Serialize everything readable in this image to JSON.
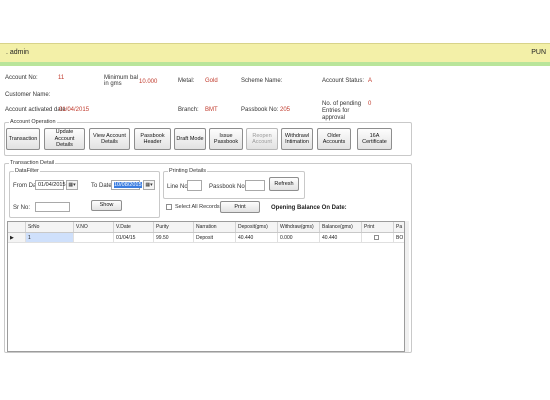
{
  "topbar": {
    "user": ". admin",
    "branch": "PUN"
  },
  "account": {
    "account_no_label": "Account No:",
    "account_no": "11",
    "min_bal_label": "Minimum bal in gms",
    "min_bal": "10.000",
    "metal_label": "Metal:",
    "metal": "Gold",
    "scheme_label": "Scheme Name:",
    "scheme": "",
    "status_label": "Account Status:",
    "status": "A",
    "customer_label": "Customer Name:",
    "customer": "",
    "activated_label": "Account activated date :",
    "activated": "01/04/2015",
    "branch_label": "Branch:",
    "branch": "BMT",
    "passbook_label": "Passbook No:",
    "passbook": "205",
    "pending_label": "No. of pending Entries for approval",
    "pending": "0"
  },
  "account_operation": {
    "title": "Account Operation",
    "buttons": [
      {
        "label": "Transaction",
        "disabled": false
      },
      {
        "label": "Update Account Details",
        "disabled": false
      },
      {
        "label": "View Account Details",
        "disabled": false
      },
      {
        "label": "Passbook Header",
        "disabled": false
      },
      {
        "label": "Draft Mode",
        "disabled": false
      },
      {
        "label": "Issue Passbook",
        "disabled": false
      },
      {
        "label": "Reopen Account",
        "disabled": true
      },
      {
        "label": "Withdrawl Intimation",
        "disabled": false
      },
      {
        "label": "Older Accounts",
        "disabled": false
      },
      {
        "label": "16A Certificate",
        "disabled": false
      }
    ]
  },
  "transaction_detail": {
    "title": "Transaction Detail",
    "datafilter_title": "DataFilter",
    "from_date_label": "From Date",
    "from_date": "01/04/2015",
    "to_date_label": "To Date",
    "to_date": "10/08/2015",
    "srno_label": "Sr No:",
    "srno": "",
    "show_button": "Show",
    "printing_title": "Printing Details",
    "line_no_label": "Line No:",
    "line_no": "",
    "passbook_no_label": "Passbook No:",
    "passbook_no": "",
    "refresh_button": "Refresh",
    "select_all_label": "Select All Records",
    "print_button": "Print",
    "opening_balance_label": "Opening Balance On Date:"
  },
  "grid": {
    "columns": [
      "SrNo",
      "V.NO",
      "V.Date",
      "Purity",
      "Narration",
      "Deposit(gms)",
      "Withdraw(gms)",
      "Balance(gms)",
      "Print",
      "Pa"
    ],
    "rows": [
      {
        "srno": "1",
        "vno": "",
        "vdate": "01/04/15",
        "purity": "99.50",
        "narration": "Deposit",
        "deposit": "40.440",
        "withdraw": "0.000",
        "balance": "40.440",
        "print": "",
        "pa": "BO"
      }
    ]
  }
}
